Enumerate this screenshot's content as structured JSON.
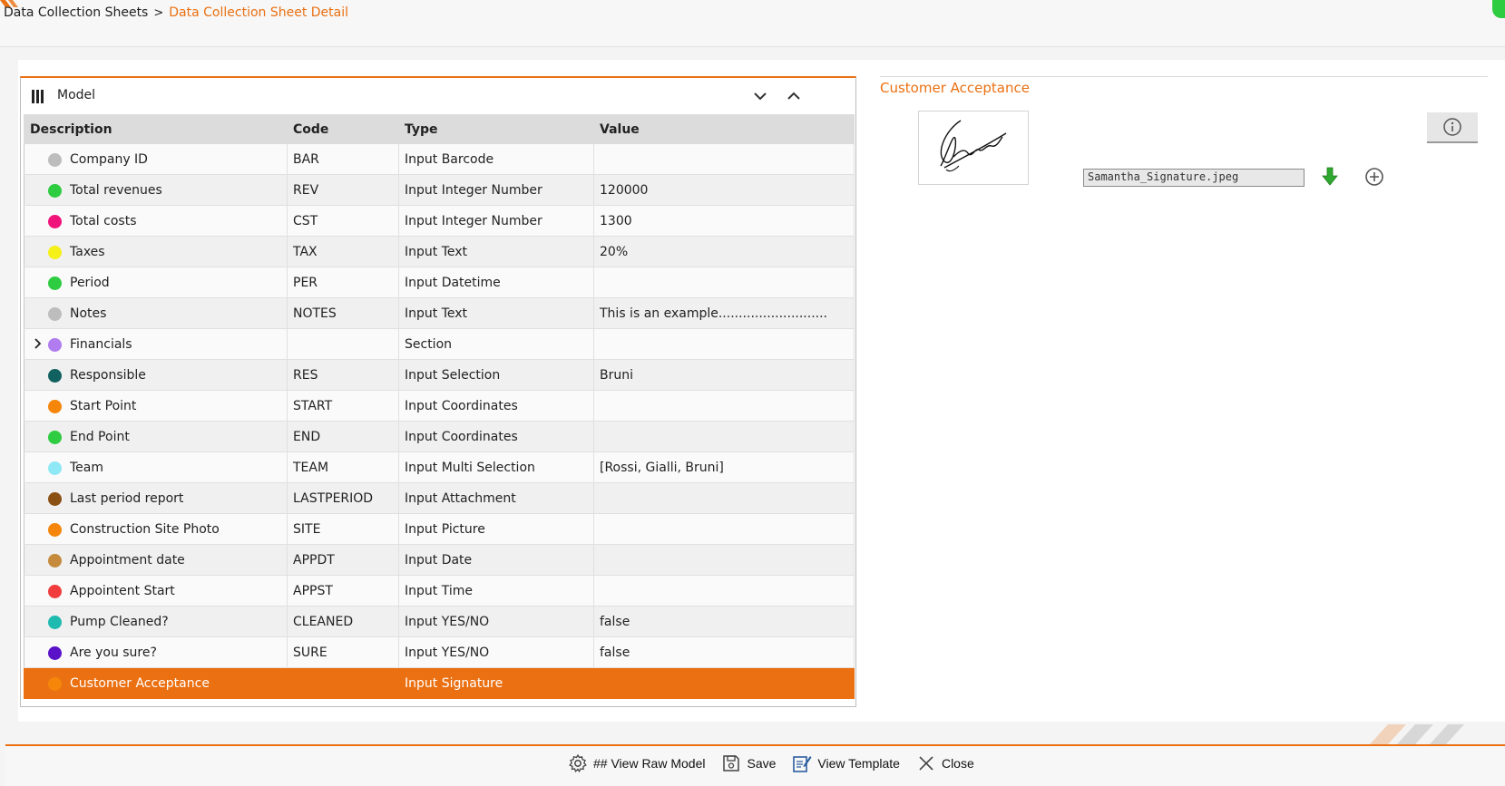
{
  "breadcrumb": {
    "parent": "Data Collection Sheets",
    "separator": ">",
    "current": "Data Collection Sheet Detail"
  },
  "model": {
    "title": "Model",
    "columns": {
      "description": "Description",
      "code": "Code",
      "type": "Type",
      "value": "Value"
    },
    "rows": [
      {
        "description": "Company ID",
        "code": "BAR",
        "type": "Input Barcode",
        "value": "",
        "color": "#bdbdbd"
      },
      {
        "description": "Total revenues",
        "code": "REV",
        "type": "Input Integer Number",
        "value": "120000",
        "color": "#2ecc40"
      },
      {
        "description": "Total costs",
        "code": "CST",
        "type": "Input Integer Number",
        "value": "1300",
        "color": "#f0137a"
      },
      {
        "description": "Taxes",
        "code": "TAX",
        "type": "Input Text",
        "value": "20%",
        "color": "#f5f018"
      },
      {
        "description": "Period",
        "code": "PER",
        "type": "Input Datetime",
        "value": "",
        "color": "#2ecc40"
      },
      {
        "description": "Notes",
        "code": "NOTES",
        "type": "Input Text",
        "value": "This is an example...........................",
        "color": "#bdbdbd"
      },
      {
        "description": "Financials",
        "code": "",
        "type": "Section",
        "value": "",
        "color": "#b07cf0"
      },
      {
        "description": "Responsible",
        "code": "RES",
        "type": "Input Selection",
        "value": "Bruni",
        "color": "#126161"
      },
      {
        "description": "Start Point",
        "code": "START",
        "type": "Input Coordinates",
        "value": "",
        "color": "#f5860a"
      },
      {
        "description": "End Point",
        "code": "END",
        "type": "Input Coordinates",
        "value": "",
        "color": "#2ecc40"
      },
      {
        "description": "Team",
        "code": "TEAM",
        "type": "Input Multi Selection",
        "value": "[Rossi, Gialli, Bruni]",
        "color": "#8fe8f5"
      },
      {
        "description": "Last period report",
        "code": "LASTPERIOD",
        "type": "Input Attachment",
        "value": "",
        "color": "#8b5014"
      },
      {
        "description": "Construction Site Photo",
        "code": "SITE",
        "type": "Input Picture",
        "value": "",
        "color": "#f5860a"
      },
      {
        "description": "Appointment date",
        "code": "APPDT",
        "type": "Input Date",
        "value": "",
        "color": "#c58a3c"
      },
      {
        "description": "Appointent Start",
        "code": "APPST",
        "type": "Input Time",
        "value": "",
        "color": "#f03c3c"
      },
      {
        "description": "Pump Cleaned?",
        "code": "CLEANED",
        "type": "Input YES/NO",
        "value": "false",
        "color": "#1fbab0"
      },
      {
        "description": "Are you sure?",
        "code": "SURE",
        "type": "Input YES/NO",
        "value": "false",
        "color": "#5a12c8"
      },
      {
        "description": "Customer Acceptance",
        "code": "",
        "type": "Input Signature",
        "value": "",
        "color": "#f5860a"
      }
    ]
  },
  "detail": {
    "title": "Customer Acceptance",
    "file_name": "Samantha_Signature.jpeg"
  },
  "footer": {
    "raw_model": "## View Raw Model",
    "save": "Save",
    "view_template": "View Template",
    "close": "Close"
  },
  "colors": {
    "accent": "#ea7012",
    "selected_row": "#ea7012",
    "download_green": "#2ea82e"
  }
}
